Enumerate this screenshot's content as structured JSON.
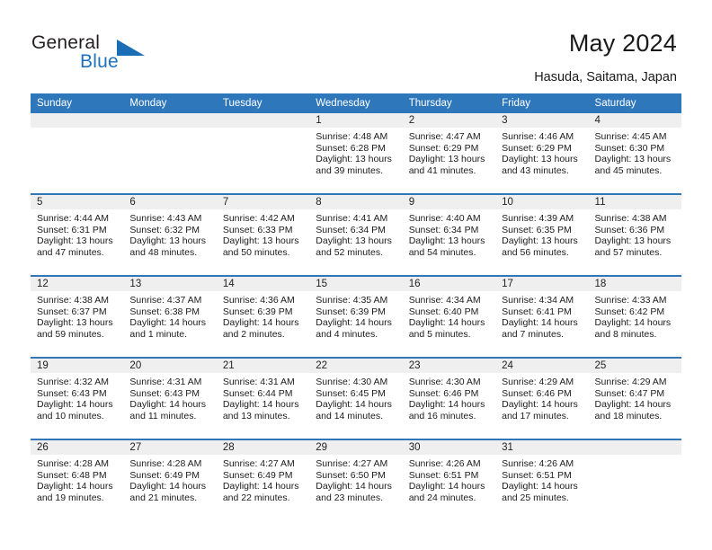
{
  "branding": {
    "logo_word_1": "General",
    "logo_word_2": "Blue",
    "logo_icon": "triangle-flag-icon",
    "brand_color": "#1b6eb5"
  },
  "header": {
    "title": "May 2024",
    "location": "Hasuda, Saitama, Japan"
  },
  "colors": {
    "header_row": "#2f77bb",
    "week_separator": "#3176b7",
    "daynum_band": "#efefef",
    "text": "#1c1c1c"
  },
  "weekday_headers": [
    "Sunday",
    "Monday",
    "Tuesday",
    "Wednesday",
    "Thursday",
    "Friday",
    "Saturday"
  ],
  "labels": {
    "sunrise_prefix": "Sunrise:",
    "sunset_prefix": "Sunset:",
    "daylight_prefix": "Daylight:"
  },
  "weeks": [
    [
      {
        "day": "",
        "empty": true
      },
      {
        "day": "",
        "empty": true
      },
      {
        "day": "",
        "empty": true
      },
      {
        "day": "1",
        "sunrise": "Sunrise: 4:48 AM",
        "sunset": "Sunset: 6:28 PM",
        "daylight": "Daylight: 13 hours and 39 minutes."
      },
      {
        "day": "2",
        "sunrise": "Sunrise: 4:47 AM",
        "sunset": "Sunset: 6:29 PM",
        "daylight": "Daylight: 13 hours and 41 minutes."
      },
      {
        "day": "3",
        "sunrise": "Sunrise: 4:46 AM",
        "sunset": "Sunset: 6:29 PM",
        "daylight": "Daylight: 13 hours and 43 minutes."
      },
      {
        "day": "4",
        "sunrise": "Sunrise: 4:45 AM",
        "sunset": "Sunset: 6:30 PM",
        "daylight": "Daylight: 13 hours and 45 minutes."
      }
    ],
    [
      {
        "day": "5",
        "sunrise": "Sunrise: 4:44 AM",
        "sunset": "Sunset: 6:31 PM",
        "daylight": "Daylight: 13 hours and 47 minutes."
      },
      {
        "day": "6",
        "sunrise": "Sunrise: 4:43 AM",
        "sunset": "Sunset: 6:32 PM",
        "daylight": "Daylight: 13 hours and 48 minutes."
      },
      {
        "day": "7",
        "sunrise": "Sunrise: 4:42 AM",
        "sunset": "Sunset: 6:33 PM",
        "daylight": "Daylight: 13 hours and 50 minutes."
      },
      {
        "day": "8",
        "sunrise": "Sunrise: 4:41 AM",
        "sunset": "Sunset: 6:34 PM",
        "daylight": "Daylight: 13 hours and 52 minutes."
      },
      {
        "day": "9",
        "sunrise": "Sunrise: 4:40 AM",
        "sunset": "Sunset: 6:34 PM",
        "daylight": "Daylight: 13 hours and 54 minutes."
      },
      {
        "day": "10",
        "sunrise": "Sunrise: 4:39 AM",
        "sunset": "Sunset: 6:35 PM",
        "daylight": "Daylight: 13 hours and 56 minutes."
      },
      {
        "day": "11",
        "sunrise": "Sunrise: 4:38 AM",
        "sunset": "Sunset: 6:36 PM",
        "daylight": "Daylight: 13 hours and 57 minutes."
      }
    ],
    [
      {
        "day": "12",
        "sunrise": "Sunrise: 4:38 AM",
        "sunset": "Sunset: 6:37 PM",
        "daylight": "Daylight: 13 hours and 59 minutes."
      },
      {
        "day": "13",
        "sunrise": "Sunrise: 4:37 AM",
        "sunset": "Sunset: 6:38 PM",
        "daylight": "Daylight: 14 hours and 1 minute."
      },
      {
        "day": "14",
        "sunrise": "Sunrise: 4:36 AM",
        "sunset": "Sunset: 6:39 PM",
        "daylight": "Daylight: 14 hours and 2 minutes."
      },
      {
        "day": "15",
        "sunrise": "Sunrise: 4:35 AM",
        "sunset": "Sunset: 6:39 PM",
        "daylight": "Daylight: 14 hours and 4 minutes."
      },
      {
        "day": "16",
        "sunrise": "Sunrise: 4:34 AM",
        "sunset": "Sunset: 6:40 PM",
        "daylight": "Daylight: 14 hours and 5 minutes."
      },
      {
        "day": "17",
        "sunrise": "Sunrise: 4:34 AM",
        "sunset": "Sunset: 6:41 PM",
        "daylight": "Daylight: 14 hours and 7 minutes."
      },
      {
        "day": "18",
        "sunrise": "Sunrise: 4:33 AM",
        "sunset": "Sunset: 6:42 PM",
        "daylight": "Daylight: 14 hours and 8 minutes."
      }
    ],
    [
      {
        "day": "19",
        "sunrise": "Sunrise: 4:32 AM",
        "sunset": "Sunset: 6:43 PM",
        "daylight": "Daylight: 14 hours and 10 minutes."
      },
      {
        "day": "20",
        "sunrise": "Sunrise: 4:31 AM",
        "sunset": "Sunset: 6:43 PM",
        "daylight": "Daylight: 14 hours and 11 minutes."
      },
      {
        "day": "21",
        "sunrise": "Sunrise: 4:31 AM",
        "sunset": "Sunset: 6:44 PM",
        "daylight": "Daylight: 14 hours and 13 minutes."
      },
      {
        "day": "22",
        "sunrise": "Sunrise: 4:30 AM",
        "sunset": "Sunset: 6:45 PM",
        "daylight": "Daylight: 14 hours and 14 minutes."
      },
      {
        "day": "23",
        "sunrise": "Sunrise: 4:30 AM",
        "sunset": "Sunset: 6:46 PM",
        "daylight": "Daylight: 14 hours and 16 minutes."
      },
      {
        "day": "24",
        "sunrise": "Sunrise: 4:29 AM",
        "sunset": "Sunset: 6:46 PM",
        "daylight": "Daylight: 14 hours and 17 minutes."
      },
      {
        "day": "25",
        "sunrise": "Sunrise: 4:29 AM",
        "sunset": "Sunset: 6:47 PM",
        "daylight": "Daylight: 14 hours and 18 minutes."
      }
    ],
    [
      {
        "day": "26",
        "sunrise": "Sunrise: 4:28 AM",
        "sunset": "Sunset: 6:48 PM",
        "daylight": "Daylight: 14 hours and 19 minutes."
      },
      {
        "day": "27",
        "sunrise": "Sunrise: 4:28 AM",
        "sunset": "Sunset: 6:49 PM",
        "daylight": "Daylight: 14 hours and 21 minutes."
      },
      {
        "day": "28",
        "sunrise": "Sunrise: 4:27 AM",
        "sunset": "Sunset: 6:49 PM",
        "daylight": "Daylight: 14 hours and 22 minutes."
      },
      {
        "day": "29",
        "sunrise": "Sunrise: 4:27 AM",
        "sunset": "Sunset: 6:50 PM",
        "daylight": "Daylight: 14 hours and 23 minutes."
      },
      {
        "day": "30",
        "sunrise": "Sunrise: 4:26 AM",
        "sunset": "Sunset: 6:51 PM",
        "daylight": "Daylight: 14 hours and 24 minutes."
      },
      {
        "day": "31",
        "sunrise": "Sunrise: 4:26 AM",
        "sunset": "Sunset: 6:51 PM",
        "daylight": "Daylight: 14 hours and 25 minutes."
      },
      {
        "day": "",
        "empty": true
      }
    ]
  ]
}
